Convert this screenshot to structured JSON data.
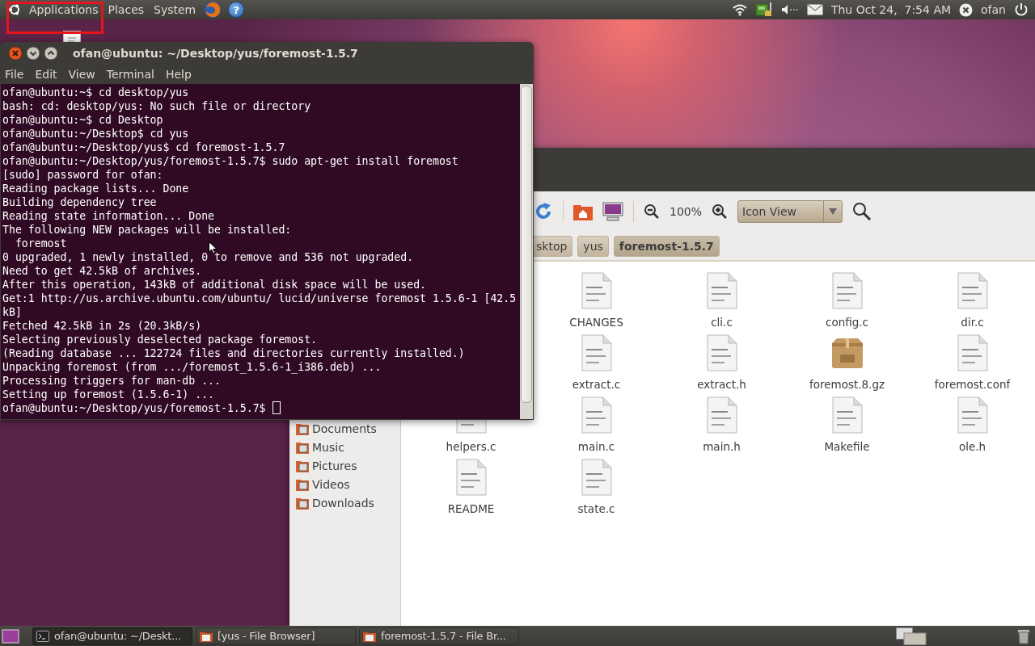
{
  "top_panel": {
    "menus": [
      "Applications",
      "Places",
      "System"
    ],
    "help_glyph": "?",
    "clock": "Thu Oct 24,  7:54 AM",
    "user": "ofan"
  },
  "terminal": {
    "title": "ofan@ubuntu: ~/Desktop/yus/foremost-1.5.7",
    "menu": [
      "File",
      "Edit",
      "View",
      "Terminal",
      "Help"
    ],
    "lines": [
      "ofan@ubuntu:~$ cd desktop/yus",
      "bash: cd: desktop/yus: No such file or directory",
      "ofan@ubuntu:~$ cd Desktop",
      "ofan@ubuntu:~/Desktop$ cd yus",
      "ofan@ubuntu:~/Desktop/yus$ cd foremost-1.5.7",
      "ofan@ubuntu:~/Desktop/yus/foremost-1.5.7$ sudo apt-get install foremost",
      "[sudo] password for ofan:",
      "Reading package lists... Done",
      "Building dependency tree",
      "Reading state information... Done",
      "The following NEW packages will be installed:",
      "  foremost",
      "0 upgraded, 1 newly installed, 0 to remove and 536 not upgraded.",
      "Need to get 42.5kB of archives.",
      "After this operation, 143kB of additional disk space will be used.",
      "Get:1 http://us.archive.ubuntu.com/ubuntu/ lucid/universe foremost 1.5.6-1 [42.5",
      "kB]",
      "Fetched 42.5kB in 2s (20.3kB/s)",
      "Selecting previously deselected package foremost.",
      "(Reading database ... 122724 files and directories currently installed.)",
      "Unpacking foremost (from .../foremost_1.5.6-1_i386.deb) ...",
      "Processing triggers for man-db ...",
      "Setting up foremost (1.5.6-1) ..."
    ],
    "prompt": "ofan@ubuntu:~/Desktop/yus/foremost-1.5.7$"
  },
  "file_browser": {
    "zoom": "100%",
    "view_mode": "Icon View",
    "path": [
      {
        "label": "sktop",
        "selected": false
      },
      {
        "label": "yus",
        "selected": false
      },
      {
        "label": "foremost-1.5.7",
        "selected": true
      }
    ],
    "places": [
      "Documents",
      "Music",
      "Pictures",
      "Videos",
      "Downloads"
    ],
    "files": [
      [
        {
          "name": "CHANGES",
          "kind": "text"
        },
        {
          "name": "cli.c",
          "kind": "text"
        },
        {
          "name": "config.c",
          "kind": "text"
        },
        {
          "name": "dir.c",
          "kind": "text"
        }
      ],
      [
        {
          "name": "extract.c",
          "kind": "text"
        },
        {
          "name": "extract.h",
          "kind": "text"
        },
        {
          "name": "foremost.8.gz",
          "kind": "archive"
        },
        {
          "name": "foremost.conf",
          "kind": "text"
        }
      ],
      [
        {
          "name": "helpers.c",
          "kind": "text"
        },
        {
          "name": "main.c",
          "kind": "text"
        },
        {
          "name": "main.h",
          "kind": "text"
        },
        {
          "name": "Makefile",
          "kind": "text"
        },
        {
          "name": "ole.h",
          "kind": "text"
        }
      ],
      [
        {
          "name": "README",
          "kind": "text"
        },
        {
          "name": "state.c",
          "kind": "text"
        }
      ]
    ]
  },
  "taskbar": {
    "tasks": [
      {
        "label": "ofan@ubuntu: ~/Deskt...",
        "kind": "terminal",
        "selected": true
      },
      {
        "label": "[yus - File Browser]",
        "kind": "folder",
        "selected": false
      },
      {
        "label": "foremost-1.5.7 - File Br...",
        "kind": "folder",
        "selected": false
      }
    ]
  }
}
